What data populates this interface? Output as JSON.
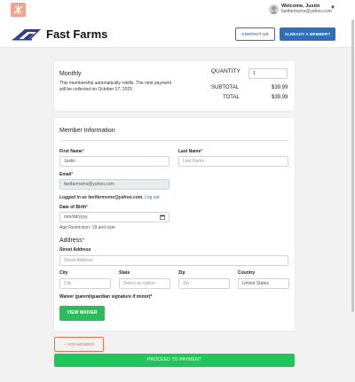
{
  "topbar": {
    "logo": "app-logo-icon",
    "welcome": "Welcome, Justin",
    "email": "fastfarmsmx@yahoo.com",
    "caret": "▼"
  },
  "header": {
    "brand": "Fast Farms",
    "contact_label": "CONTACT US",
    "member_label": "ALREADY A MEMBER?",
    "accent": "#2f6fb5"
  },
  "summary": {
    "plan": "Monthly",
    "description": "This membership automatically rebills. The next payment will be collected on October 17, 2025",
    "quantity_label": "QUANTITY",
    "quantity_value": "1",
    "subtotal_label": "SUBTOTAL",
    "subtotal_value": "$39.99",
    "total_label": "TOTAL",
    "total_value": "$39.99"
  },
  "member": {
    "title": "Member Information",
    "first_name_label": "First Name",
    "first_name_value": "Justin",
    "last_name_label": "Last Name",
    "last_name_placeholder": "Last Name",
    "email_label": "Email",
    "email_value": "fastfarmsmx@yahoo.com",
    "logged_in_prefix": "Logged in as fastfarmsmx@yahoo.com.",
    "logout": "Log out",
    "dob_label": "Date of Birth",
    "dob_placeholder": "mm/dd/yyyy",
    "age_restriction": "Age Restriction: 18 and over",
    "address_title": "Address",
    "street_label": "Street Address",
    "street_placeholder": "Street Address",
    "city_label": "City",
    "city_placeholder": "City",
    "state_label": "State",
    "state_placeholder": "Select an option",
    "zip_label": "Zip",
    "zip_placeholder": "Zip",
    "country_label": "Country",
    "country_value": "United States",
    "waiver_label": "Waiver (parent/guardian signature if minor)",
    "waiver_button": "VIEW WAIVER",
    "required_mark": "*"
  },
  "footer": {
    "add_member": "+ ADD MEMBER",
    "proceed": "PROCEED TO PAYMENT"
  }
}
